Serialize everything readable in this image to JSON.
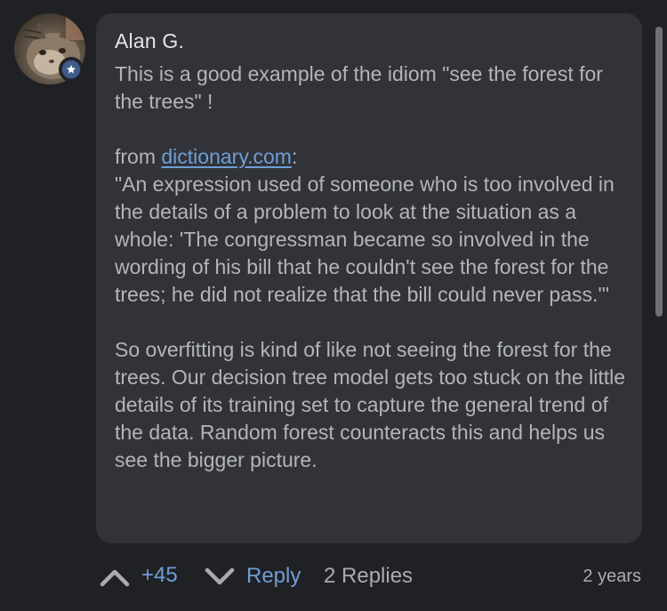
{
  "comment": {
    "author": "Alan G.",
    "avatar_icon": "cat-avatar",
    "badge_icon": "star-icon",
    "paragraph1": "This is a good example of the idiom \"see the forest for the trees\" !",
    "source_prefix": "from ",
    "source_link": "dictionary.com",
    "source_suffix": ":",
    "quote": "\"An expression used of someone who is too involved in the details of a problem to look at the situation as a whole: 'The congressman became so involved in the wording of his bill that he couldn't see the forest for the trees; he did not realize that the bill could never pass.'\"",
    "paragraph3": "So overfitting is kind of like not seeing the forest for the trees. Our decision tree model gets too stuck on the little details of its training set to capture the general trend of the data. Random forest counteracts this and helps us see the bigger picture."
  },
  "actions": {
    "upvote_icon": "chevron-up-icon",
    "score": "+45",
    "downvote_icon": "chevron-down-icon",
    "reply_label": "Reply",
    "replies_label": "2 Replies",
    "timestamp": "2 years"
  },
  "colors": {
    "background": "#202125",
    "bubble": "#313338",
    "accent": "#6f9ed6",
    "text": "#b3b5ba"
  }
}
